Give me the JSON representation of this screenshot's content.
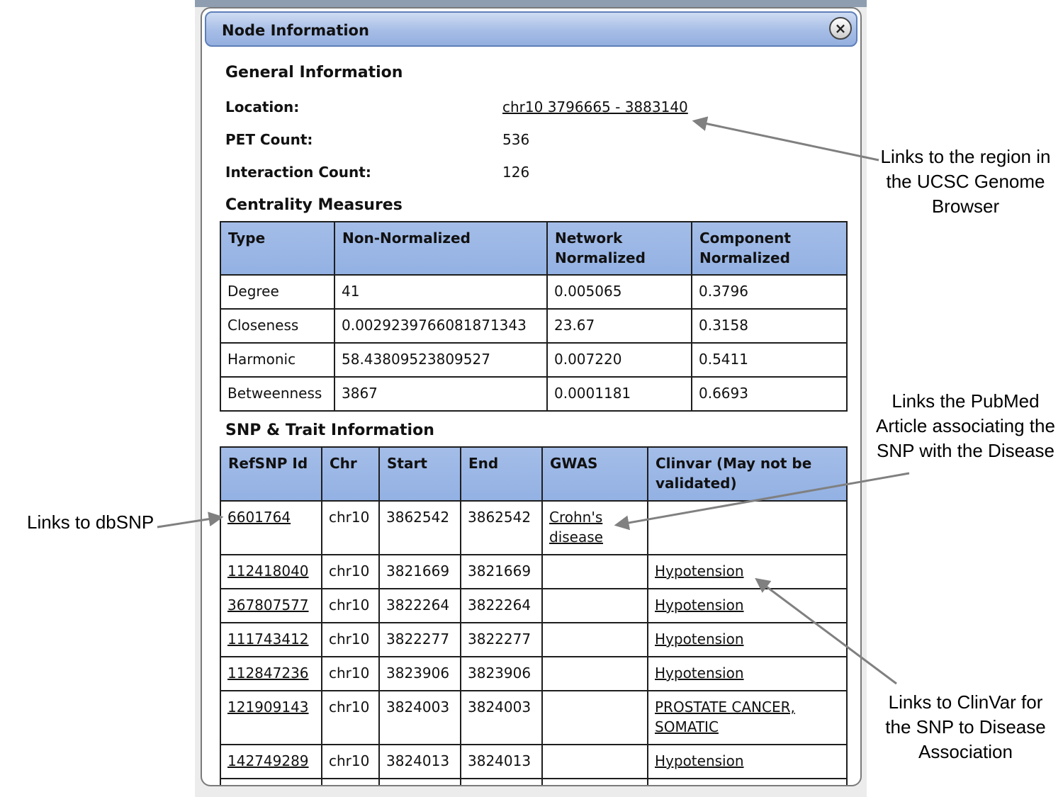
{
  "dialog": {
    "title": "Node Information",
    "close_label": "×"
  },
  "general": {
    "heading": "General Information",
    "location_label": "Location:",
    "location_value": "chr10 3796665 - 3883140",
    "pet_label": "PET Count:",
    "pet_value": "536",
    "interaction_label": "Interaction Count:",
    "interaction_value": "126"
  },
  "centrality": {
    "heading": "Centrality Measures",
    "columns": [
      "Type",
      "Non-Normalized",
      "Network Normalized",
      "Component Normalized"
    ],
    "rows": [
      [
        "Degree",
        "41",
        "0.005065",
        "0.3796"
      ],
      [
        "Closeness",
        "0.0029239766081871343",
        "23.67",
        "0.3158"
      ],
      [
        "Harmonic",
        "58.43809523809527",
        "0.007220",
        "0.5411"
      ],
      [
        "Betweenness",
        "3867",
        "0.0001181",
        "0.6693"
      ]
    ]
  },
  "snp": {
    "heading": "SNP & Trait Information",
    "columns": [
      "RefSNP Id",
      "Chr",
      "Start",
      "End",
      "GWAS",
      "Clinvar (May not be validated)"
    ],
    "rows": [
      [
        "6601764",
        "chr10",
        "3862542",
        "3862542",
        "Crohn's disease",
        ""
      ],
      [
        "112418040",
        "chr10",
        "3821669",
        "3821669",
        "",
        "Hypotension"
      ],
      [
        "367807577",
        "chr10",
        "3822264",
        "3822264",
        "",
        "Hypotension"
      ],
      [
        "111743412",
        "chr10",
        "3822277",
        "3822277",
        "",
        "Hypotension"
      ],
      [
        "112847236",
        "chr10",
        "3823906",
        "3823906",
        "",
        "Hypotension"
      ],
      [
        "121909143",
        "chr10",
        "3824003",
        "3824003",
        "",
        "PROSTATE CANCER, SOMATIC"
      ],
      [
        "142749289",
        "chr10",
        "3824013",
        "3824013",
        "",
        "Hypotension"
      ]
    ]
  },
  "annotations": {
    "ucsc": "Links to the region in the UCSC Genome Browser",
    "pubmed": "Links the PubMed Article associating the SNP with the Disease",
    "dbsnp": "Links to dbSNP",
    "clinvar": "Links to ClinVar for the SNP to Disease Association"
  },
  "colors": {
    "header_blue": "#93b1e3",
    "titlebar_blue": "#a6bde6",
    "arrow_gray": "#808080"
  }
}
